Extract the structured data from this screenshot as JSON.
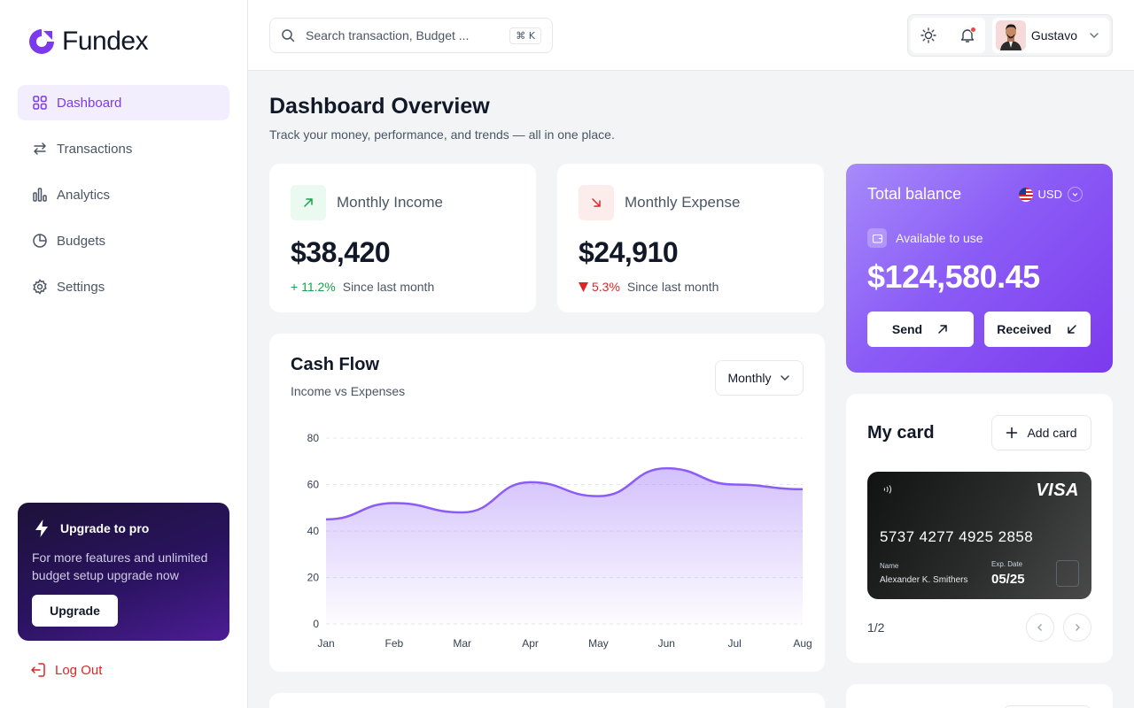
{
  "app": {
    "name": "Fundex"
  },
  "colors": {
    "accent": "#7c3aed",
    "income": "#16a34a",
    "expense": "#dc2626"
  },
  "sidebar": {
    "items": [
      {
        "label": "Dashboard",
        "icon": "grid-icon",
        "active": true
      },
      {
        "label": "Transactions",
        "icon": "arrows-swap-icon",
        "active": false
      },
      {
        "label": "Analytics",
        "icon": "bar-chart-icon",
        "active": false
      },
      {
        "label": "Budgets",
        "icon": "pie-chart-icon",
        "active": false
      },
      {
        "label": "Settings",
        "icon": "gear-icon",
        "active": false
      }
    ],
    "upgrade": {
      "title": "Upgrade to pro",
      "text": "For more features and unlimited budget setup upgrade now",
      "button": "Upgrade"
    },
    "logout": "Log Out"
  },
  "header": {
    "search_placeholder": "Search transaction, Budget ...",
    "shortcut": "⌘ K",
    "user_name": "Gustavo"
  },
  "page": {
    "title": "Dashboard Overview",
    "subtitle": "Track your money, performance, and trends — all in one place."
  },
  "stats": {
    "income": {
      "label": "Monthly Income",
      "value": "$38,420",
      "change": "+ 11.2%",
      "note": "Since last month"
    },
    "expense": {
      "label": "Monthly Expense",
      "value": "$24,910",
      "change": "5.3%",
      "note": "Since last month"
    }
  },
  "cash_flow": {
    "title": "Cash Flow",
    "subtitle": "Income vs Expenses",
    "period": "Monthly"
  },
  "chart_data": {
    "type": "area",
    "title": "Cash Flow",
    "subtitle": "Income vs Expenses",
    "categories": [
      "Jan",
      "Feb",
      "Mar",
      "Apr",
      "May",
      "Jun",
      "Jul",
      "Aug"
    ],
    "series": [
      {
        "values": [
          45,
          52,
          48,
          61,
          55,
          67,
          60,
          58
        ]
      }
    ],
    "yticks": [
      0,
      20,
      40,
      60,
      80
    ],
    "ylim": [
      0,
      80
    ],
    "grid": true,
    "color": "#8b5cf6"
  },
  "balance": {
    "title": "Total balance",
    "currency": "USD",
    "available_label": "Available to use",
    "value": "$124,580.45",
    "send": "Send",
    "received": "Received"
  },
  "my_card": {
    "title": "My card",
    "add_label": "Add card",
    "brand": "VISA",
    "number": "5737 4277 4925 2858",
    "name_label": "Name",
    "holder": "Alexander K. Smithers",
    "exp_label": "Exp. Date",
    "exp": "05/25",
    "pager": "1/2"
  }
}
